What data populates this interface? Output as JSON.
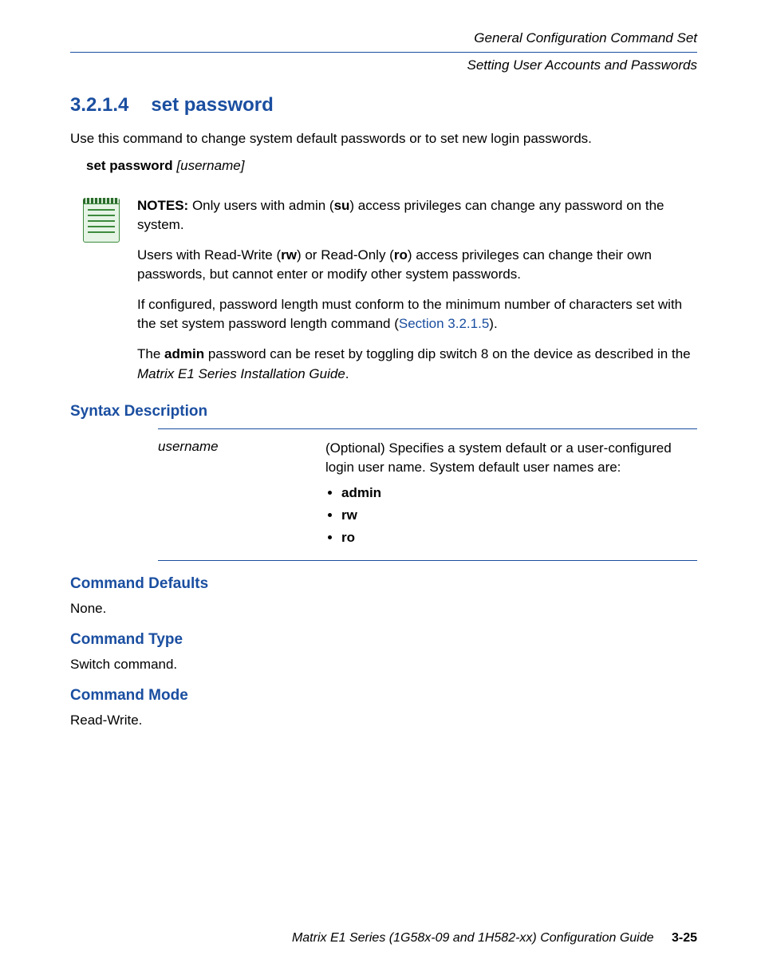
{
  "header": {
    "chapter": "General Configuration Command Set",
    "section": "Setting User Accounts and Passwords"
  },
  "title": {
    "number": "3.2.1.4",
    "text": "set password"
  },
  "intro": "Use this command to change system default passwords or to set new login passwords.",
  "syntax_cmd": "set password",
  "syntax_args": "[username]",
  "notes": {
    "label": "NOTES:",
    "p1a": "  Only users with admin (",
    "p1b": "su",
    "p1c": ") access privileges can change any password on the system.",
    "p2a": "Users with Read-Write (",
    "p2b": "rw",
    "p2c": ") or Read-Only (",
    "p2d": "ro",
    "p2e": ") access privileges can change their own passwords, but cannot enter or modify other system passwords.",
    "p3a": "If configured, password length must conform to the minimum number of characters set with the set system password length command (",
    "p3link": "Section 3.2.1.5",
    "p3b": ").",
    "p4a": "The ",
    "p4b": "admin",
    "p4c": " password can be reset by toggling dip switch 8 on the device as described in the ",
    "p4d": "Matrix E1 Series Installation Guide",
    "p4e": "."
  },
  "syntax_desc_heading": "Syntax Description",
  "syntax_table": {
    "key": "username",
    "val_lead": "(Optional) Specifies a system default or a user-configured login user name. System default user names are:",
    "items": [
      "admin",
      "rw",
      "ro"
    ]
  },
  "command_defaults": {
    "heading": "Command Defaults",
    "text": "None."
  },
  "command_type": {
    "heading": "Command Type",
    "text": "Switch command."
  },
  "command_mode": {
    "heading": "Command Mode",
    "text": "Read-Write."
  },
  "footer": {
    "doc": "Matrix E1 Series (1G58x-09 and 1H582-xx) Configuration Guide",
    "page": "3-25"
  }
}
